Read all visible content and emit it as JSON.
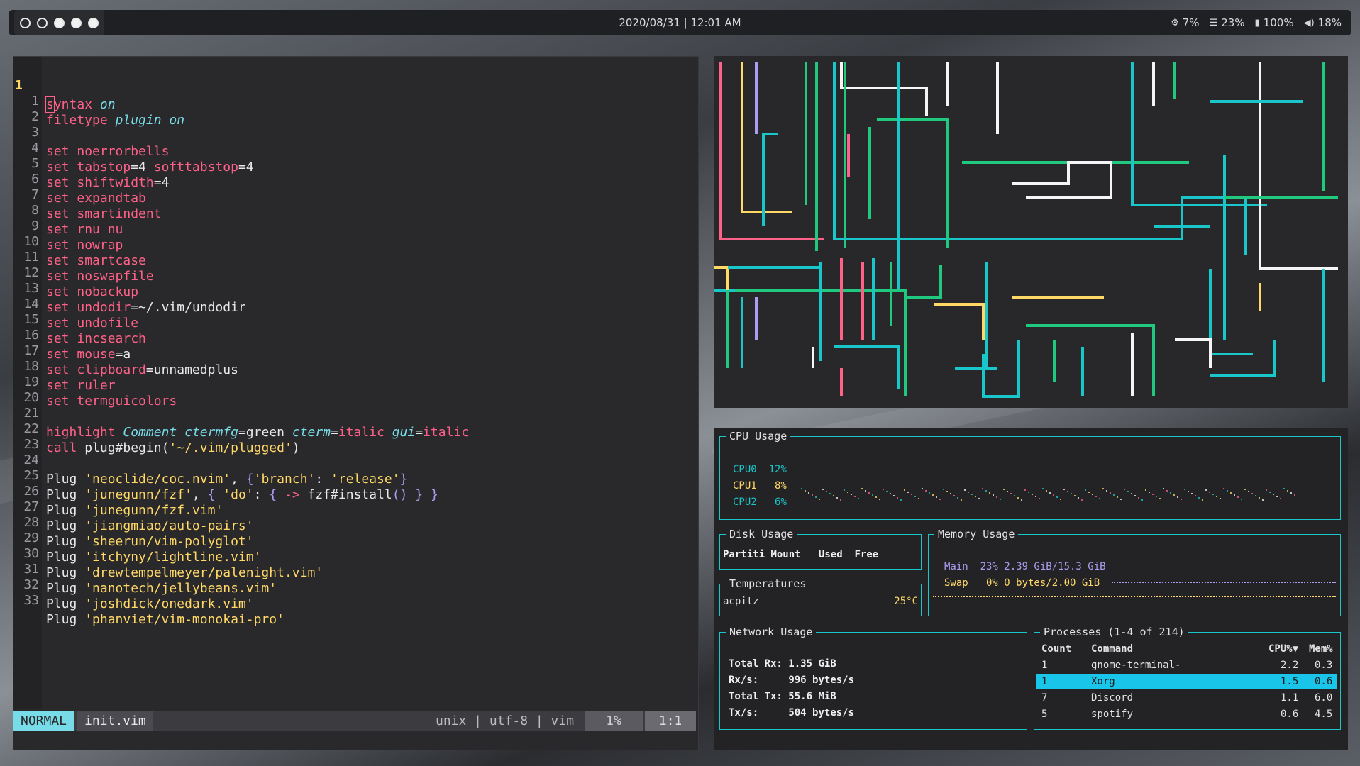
{
  "topbar": {
    "workspaces": [
      {
        "state": "empty"
      },
      {
        "state": "empty"
      },
      {
        "state": "filled"
      },
      {
        "state": "filled"
      },
      {
        "state": "filled"
      }
    ],
    "clock": "2020/08/31 | 12:01 AM",
    "status": [
      {
        "icon": "cpu-icon",
        "glyph": "⚙",
        "value": "7%"
      },
      {
        "icon": "memory-icon",
        "glyph": "☰",
        "value": "23%"
      },
      {
        "icon": "battery-icon",
        "glyph": "▮",
        "value": "100%"
      },
      {
        "icon": "volume-icon",
        "glyph": "◀)",
        "value": "18%"
      }
    ]
  },
  "vim": {
    "lines": [
      {
        "n": "1",
        "current": true
      },
      {
        "n": "1"
      },
      {
        "n": "2"
      },
      {
        "n": "3"
      },
      {
        "n": "4"
      },
      {
        "n": "5"
      },
      {
        "n": "6"
      },
      {
        "n": "7"
      },
      {
        "n": "8"
      },
      {
        "n": "9"
      },
      {
        "n": "10"
      },
      {
        "n": "11"
      },
      {
        "n": "12"
      },
      {
        "n": "13"
      },
      {
        "n": "14"
      },
      {
        "n": "15"
      },
      {
        "n": "16"
      },
      {
        "n": "17"
      },
      {
        "n": "18"
      },
      {
        "n": "19"
      },
      {
        "n": "20"
      },
      {
        "n": "21"
      },
      {
        "n": "22"
      },
      {
        "n": "23"
      },
      {
        "n": "24"
      },
      {
        "n": "25"
      },
      {
        "n": "26"
      },
      {
        "n": "27"
      },
      {
        "n": "28"
      },
      {
        "n": "29"
      },
      {
        "n": "30"
      },
      {
        "n": "31"
      },
      {
        "n": "32"
      },
      {
        "n": "33"
      }
    ],
    "code": {
      "l0_a": "s",
      "l0_b": "yntax",
      "l0_c": "on",
      "l1_a": "filetype",
      "l1_b": "plugin",
      "l1_c": "on",
      "set": "set",
      "l3": "noerrorbells",
      "l4_a": "tabstop",
      "l4_b": "=4 ",
      "l4_c": "softtabstop",
      "l4_d": "=4",
      "l5_a": "shiftwidth",
      "l5_b": "=4",
      "l6": "expandtab",
      "l7": "smartindent",
      "l8": "rnu nu",
      "l9": "nowrap",
      "l10": "smartcase",
      "l11": "noswapfile",
      "l12": "nobackup",
      "l13_a": "undodir",
      "l13_b": "=~/.vim/undodir",
      "l14": "undofile",
      "l15": "incsearch",
      "l16_a": "mouse",
      "l16_b": "=a",
      "l17_a": "clipboard",
      "l17_b": "=unnamedplus",
      "l18": "ruler",
      "l19": "termguicolors",
      "l21_a": "highlight",
      "l21_b": "Comment",
      "l21_c": "ctermfg",
      "l21_d": "=green ",
      "l21_e": "cterm",
      "l21_f": "=",
      "l21_g": "italic",
      "l21_h": "gui",
      "l21_i": "=",
      "l21_j": "italic",
      "l22_a": "call",
      "l22_b": " plug#begin(",
      "l22_c": "'~/.vim/plugged'",
      "l22_d": ")",
      "plug": "Plug ",
      "l24_a": "'neoclide/coc.nvim'",
      "l24_b": ", ",
      "l24_c": "{",
      "l24_d": "'branch'",
      "l24_e": ": ",
      "l24_f": "'release'",
      "l24_g": "}",
      "l25_a": "'junegunn/fzf'",
      "l25_b": ", ",
      "l25_c": "{ ",
      "l25_d": "'do'",
      "l25_e": ": ",
      "l25_f": "{ ",
      "l25_g": "->",
      "l25_h": " fzf#install",
      "l25_i": "()",
      "l25_j": " } }",
      "l26": "'junegunn/fzf.vim'",
      "l27": "'jiangmiao/auto-pairs'",
      "l28": "'sheerun/vim-polyglot'",
      "l29": "'itchyny/lightline.vim'",
      "l30": "'drewtempelmeyer/palenight.vim'",
      "l31": "'nanotech/jellybeans.vim'",
      "l32": "'joshdick/onedark.vim'",
      "l33": "'phanviet/vim-monokai-pro'"
    },
    "statusline": {
      "mode": "NORMAL",
      "file": "init.vim",
      "info": "unix | utf-8 | vim",
      "percent": "1%",
      "position": "1:1"
    }
  },
  "gtop": {
    "cpu": {
      "title": "CPU Usage",
      "cores": [
        {
          "name": "CPU0",
          "value": "12%"
        },
        {
          "name": "CPU1",
          "value": "8%"
        },
        {
          "name": "CPU2",
          "value": "6%"
        }
      ]
    },
    "disk": {
      "title": "Disk Usage",
      "headers": [
        "Partiti",
        "Mount",
        "Used",
        "Free"
      ]
    },
    "temperatures": {
      "title": "Temperatures",
      "sensor": "acpitz",
      "value": "25°C"
    },
    "memory": {
      "title": "Memory Usage",
      "main": "Main  23% 2.39 GiB/15.3 GiB",
      "swap": "Swap   0% 0 bytes/2.00 GiB"
    },
    "network": {
      "title": "Network Usage",
      "rows": [
        {
          "label": "Total Rx:",
          "value": "1.35 GiB"
        },
        {
          "label": "Rx/s:",
          "value": "996 bytes/s"
        },
        {
          "label": "Total Tx:",
          "value": "55.6 MiB"
        },
        {
          "label": "Tx/s:",
          "value": "504 bytes/s"
        }
      ]
    },
    "processes": {
      "title": "Processes (1-4 of 214)",
      "headers": {
        "count": "Count",
        "command": "Command",
        "cpu": "CPU%▼",
        "mem": "Mem%"
      },
      "rows": [
        {
          "count": "1",
          "command": "gnome-terminal-",
          "cpu": "2.2",
          "mem": "0.3",
          "selected": false
        },
        {
          "count": "1",
          "command": "Xorg",
          "cpu": "1.5",
          "mem": "0.6",
          "selected": true
        },
        {
          "count": "7",
          "command": "Discord",
          "cpu": "1.1",
          "mem": "6.0",
          "selected": false
        },
        {
          "count": "5",
          "command": "spotify",
          "cpu": "0.6",
          "mem": "4.5",
          "selected": false
        }
      ]
    }
  },
  "colors": {
    "accent": "#19c6c9",
    "pink": "#ff6188",
    "yellow": "#ffd866",
    "purple": "#ab9df2",
    "green": "#1fc97e",
    "white": "#f5f5f5"
  }
}
